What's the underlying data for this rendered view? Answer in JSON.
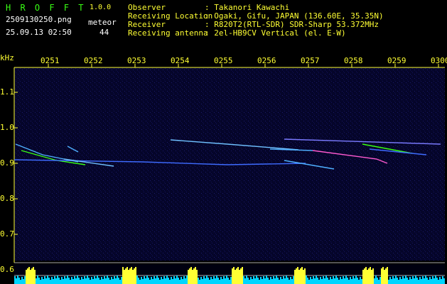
{
  "app": {
    "name": "H R O F F T",
    "version": "1.0.0",
    "filename": "2509130250.png",
    "datetime": "25.09.13 02:50",
    "counter_label": "meteor",
    "counter_value": "44"
  },
  "info": {
    "rows": [
      {
        "label": "Observer",
        "value": ": Takanori Kawachi"
      },
      {
        "label": "Receiving Location",
        "value": ": Ogaki, Gifu, JAPAN (136.60E, 35.35N)"
      },
      {
        "label": "Receiver",
        "value": ": R820T2(RTL-SDR) SDR-Sharp 53.372MHz"
      },
      {
        "label": "Receiving antenna",
        "value": ": 2el-HB9CV Vertical (el. E-W)"
      }
    ]
  },
  "colors": {
    "background": "#000000",
    "spectrum_bg": "#0a0a3a",
    "axis": "#ffff33",
    "text_green": "#39ff14",
    "text_white": "#ffffff",
    "trail_main": "#4fb0ff",
    "trail_hot": "#ff5ad0",
    "baseline_fill": "#00d5ff",
    "peak_fill": "#ffff33"
  },
  "chart_data": {
    "type": "heatmap",
    "ylabel": "kHz",
    "x_ticks": [
      "0251",
      "0252",
      "0253",
      "0254",
      "0255",
      "0256",
      "0257",
      "0258",
      "0259",
      "0300"
    ],
    "y_ticks": [
      "1.1",
      "1.0",
      "0.9",
      "0.8",
      "0.7",
      "0.6"
    ],
    "y_lower_axis_labels": [
      "0.6"
    ]
  }
}
